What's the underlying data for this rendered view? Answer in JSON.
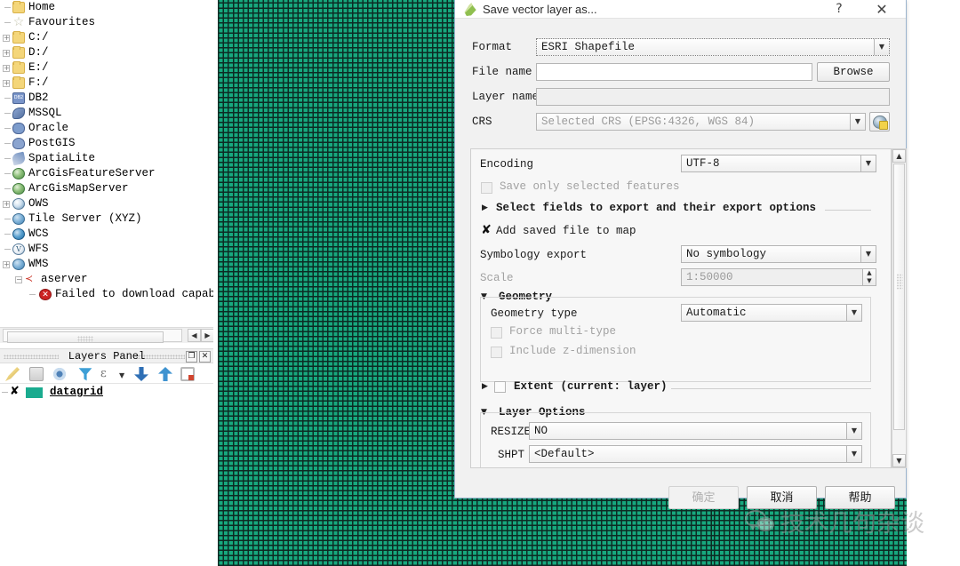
{
  "browser": {
    "items": [
      {
        "label": "Home",
        "icon": "folder-icon",
        "indent": 0,
        "expander": ""
      },
      {
        "label": "Favourites",
        "icon": "star-icon",
        "indent": 0,
        "expander": ""
      },
      {
        "label": "C:/",
        "icon": "folder-icon",
        "indent": 0,
        "expander": "+"
      },
      {
        "label": "D:/",
        "icon": "folder-icon",
        "indent": 0,
        "expander": "+"
      },
      {
        "label": "E:/",
        "icon": "folder-icon",
        "indent": 0,
        "expander": "+"
      },
      {
        "label": "F:/",
        "icon": "folder-icon",
        "indent": 0,
        "expander": "+"
      },
      {
        "label": "DB2",
        "icon": "db2-icon",
        "indent": 0,
        "expander": ""
      },
      {
        "label": "MSSQL",
        "icon": "mssql-icon",
        "indent": 0,
        "expander": ""
      },
      {
        "label": "Oracle",
        "icon": "oracle-icon",
        "indent": 0,
        "expander": ""
      },
      {
        "label": "PostGIS",
        "icon": "postgis-icon",
        "indent": 0,
        "expander": ""
      },
      {
        "label": "SpatiaLite",
        "icon": "spatialite-icon",
        "indent": 0,
        "expander": ""
      },
      {
        "label": "ArcGisFeatureServer",
        "icon": "arcgis-feature-icon",
        "indent": 0,
        "expander": ""
      },
      {
        "label": "ArcGisMapServer",
        "icon": "arcgis-map-icon",
        "indent": 0,
        "expander": ""
      },
      {
        "label": "OWS",
        "icon": "ows-globe-icon",
        "indent": 0,
        "expander": "+"
      },
      {
        "label": "Tile Server (XYZ)",
        "icon": "tile-server-icon",
        "indent": 0,
        "expander": ""
      },
      {
        "label": "WCS",
        "icon": "wcs-globe-icon",
        "indent": 0,
        "expander": ""
      },
      {
        "label": "WFS",
        "icon": "wfs-globe-icon",
        "indent": 0,
        "expander": ""
      },
      {
        "label": "WMS",
        "icon": "wms-globe-icon",
        "indent": 0,
        "expander": "+"
      },
      {
        "label": "aserver",
        "icon": "connection-icon",
        "indent": 1,
        "expander": "-"
      },
      {
        "label": "Failed to download capabi",
        "icon": "error-icon",
        "indent": 2,
        "expander": ""
      }
    ]
  },
  "layers_panel": {
    "title": "Layers Panel",
    "window_buttons": [
      "❐",
      "✕"
    ],
    "toolbar_icons": [
      "open-layer-styling-icon",
      "add-group-icon",
      "manage-visibility-icon",
      "filter-legend-icon",
      "expression-filter-icon",
      "expression-dropdown-icon",
      "expand-all-icon",
      "collapse-all-icon",
      "remove-layer-icon"
    ],
    "layer": {
      "name": "datagrid",
      "checked_mark": "✘",
      "swatch_color": "#1aab8f"
    }
  },
  "map_canvas": {
    "fill_color": "#17a87e",
    "grid_line_color": "#0d2b24"
  },
  "dialog": {
    "title": "Save vector layer as...",
    "titlebar_buttons": {
      "help": "?",
      "close": "✕"
    },
    "format": {
      "label": "Format",
      "value": "ESRI Shapefile"
    },
    "file_name": {
      "label": "File name",
      "value": "",
      "browse": "Browse"
    },
    "layer_name": {
      "label": "Layer name",
      "value": ""
    },
    "crs": {
      "label": "CRS",
      "value": "Selected CRS (EPSG:4326, WGS 84)"
    },
    "encoding": {
      "label": "Encoding",
      "value": "UTF-8"
    },
    "save_only_selected": {
      "label": "Save only selected features",
      "checked": false,
      "enabled": false
    },
    "select_fields_section": {
      "label": "Select fields to export and their export options",
      "expanded": false
    },
    "add_saved_file": {
      "label": "Add saved file to map",
      "checked": true,
      "mark": "✘"
    },
    "symbology_export": {
      "label": "Symbology export",
      "value": "No symbology"
    },
    "scale": {
      "label": "Scale",
      "value": "1:50000",
      "enabled": false
    },
    "geometry": {
      "section_label": "Geometry",
      "expanded": true,
      "type_label": "Geometry type",
      "type_value": "Automatic",
      "force_multi": {
        "label": "Force multi-type",
        "checked": false,
        "enabled": false
      },
      "include_z": {
        "label": "Include z-dimension",
        "checked": false,
        "enabled": false
      }
    },
    "extent": {
      "label": "Extent (current: layer)",
      "checked": false,
      "expanded": false
    },
    "layer_options": {
      "section_label": "Layer Options",
      "expanded": true,
      "rows": [
        {
          "key": "RESIZE",
          "value": "NO"
        },
        {
          "key": "SHPT",
          "value": "<Default>"
        }
      ]
    },
    "buttons": {
      "ok": "确定",
      "cancel": "取消",
      "help": "帮助"
    }
  },
  "watermark": {
    "text": "技术几句杂谈"
  }
}
